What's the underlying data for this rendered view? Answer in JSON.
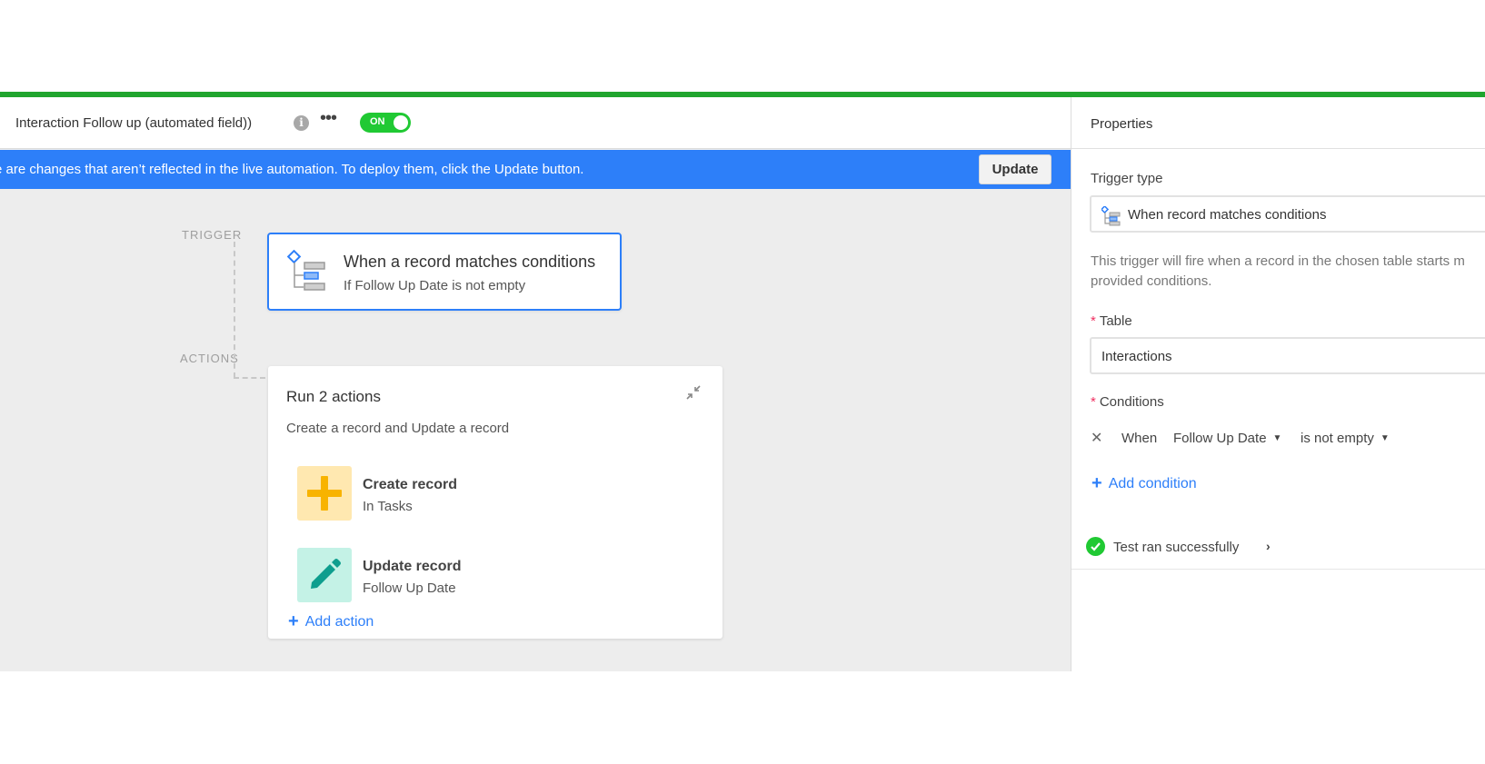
{
  "header": {
    "automation_name": "Interaction Follow up (automated field))",
    "toggle_label": "ON"
  },
  "banner": {
    "message": "e are changes that aren’t reflected in the live automation. To deploy them, click the Update button.",
    "update_button": "Update"
  },
  "canvas": {
    "trigger_label": "TRIGGER",
    "actions_label": "ACTIONS",
    "trigger": {
      "title": "When a record matches conditions",
      "subtitle": "If Follow Up Date is not empty"
    },
    "actions": {
      "title": "Run 2 actions",
      "subtitle": "Create a record and Update a record",
      "items": [
        {
          "title": "Create record",
          "subtitle": "In Tasks",
          "icon": "plus-icon",
          "tile_color": "#ffe8b0",
          "icon_color": "#f8b300"
        },
        {
          "title": "Update record",
          "subtitle": "Follow Up Date",
          "icon": "pencil-icon",
          "tile_color": "#c4f2e6",
          "icon_color": "#0e9e8e"
        }
      ],
      "add_action": "Add action"
    }
  },
  "properties": {
    "title": "Properties",
    "trigger_type_label": "Trigger type",
    "trigger_type_value": "When record matches conditions",
    "description_line1": "This trigger will fire when a record in the chosen table starts m",
    "description_line2": "provided conditions.",
    "table_label": "Table",
    "table_value": "Interactions",
    "conditions_label": "Conditions",
    "condition": {
      "when": "When",
      "field": "Follow Up Date",
      "operator": "is not empty"
    },
    "add_condition": "Add condition",
    "test_status": "Test ran successfully"
  },
  "colors": {
    "accent_blue": "#2d7ff9",
    "success_green": "#20c933",
    "top_bar_green": "#20a52e",
    "required_red": "#ef3061"
  }
}
